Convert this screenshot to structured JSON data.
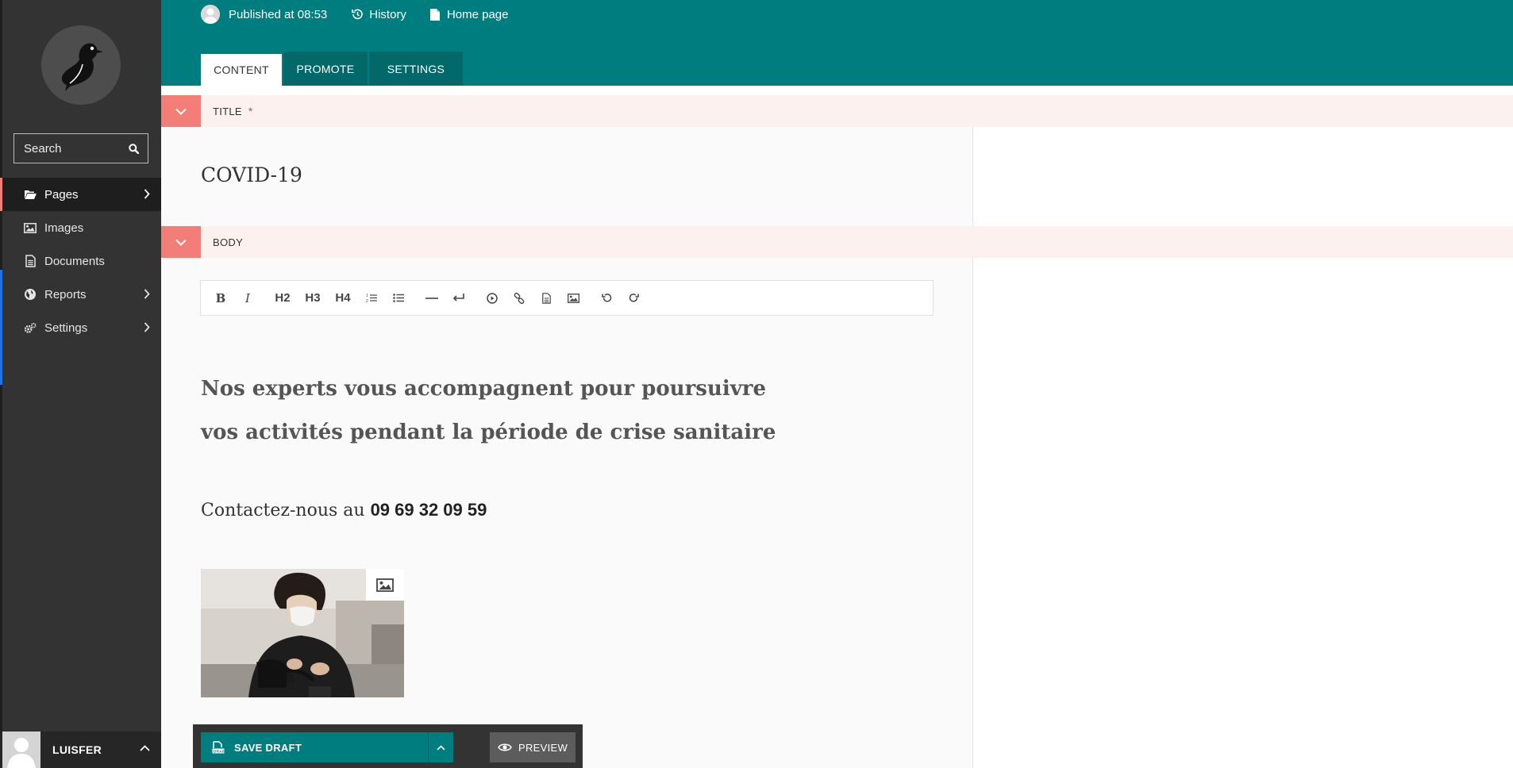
{
  "sidebar": {
    "search_placeholder": "Search",
    "items": [
      {
        "label": "Pages",
        "icon": "folder-open-icon",
        "active": true,
        "has_submenu": true
      },
      {
        "label": "Images",
        "icon": "image-icon",
        "active": false,
        "has_submenu": false
      },
      {
        "label": "Documents",
        "icon": "document-icon",
        "active": false,
        "has_submenu": false
      },
      {
        "label": "Reports",
        "icon": "globe-icon",
        "active": false,
        "has_submenu": true
      },
      {
        "label": "Settings",
        "icon": "cogs-icon",
        "active": false,
        "has_submenu": true
      }
    ],
    "user": {
      "name": "LUISFER"
    }
  },
  "header": {
    "status": "Published at 08:53",
    "history_label": "History",
    "home_label": "Home page",
    "tabs": [
      {
        "label": "CONTENT",
        "active": true
      },
      {
        "label": "PROMOTE",
        "active": false
      },
      {
        "label": "SETTINGS",
        "active": false
      }
    ]
  },
  "content": {
    "title_section": {
      "label": "TITLE",
      "required_marker": "*",
      "value": "COVID-19"
    },
    "body_section": {
      "label": "BODY",
      "toolbar": [
        "B",
        "I",
        "H2",
        "H3",
        "H4"
      ],
      "heading": "Nos experts vous accompagnent pour poursuivre vos activités pendant la période de crise sanitaire",
      "contact_prefix": "Contactez-nous au ",
      "phone": "09 69 32 09 59"
    }
  },
  "actions": {
    "save_label": "SAVE DRAFT",
    "preview_label": "PREVIEW"
  },
  "colors": {
    "teal": "#007d7e",
    "sidebar": "#333333",
    "salmon": "#f37e77",
    "section_bg": "#fdf1f0"
  }
}
